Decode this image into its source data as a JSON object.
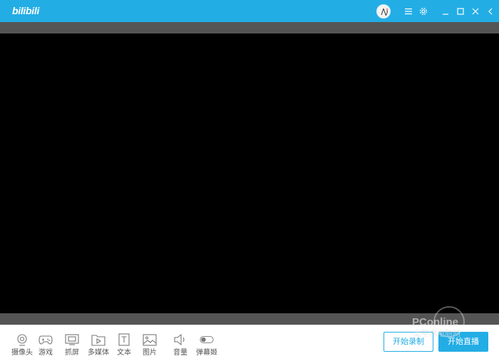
{
  "app": {
    "logo_text": "bilibili"
  },
  "titlebar": {
    "icons": [
      "avatar",
      "menu-icon",
      "settings-icon",
      "minimize-icon",
      "maximize-icon",
      "close-icon",
      "collapse-icon"
    ]
  },
  "toolbar": {
    "items": [
      {
        "label": "摄像头",
        "icon": "camera-icon"
      },
      {
        "label": "游戏",
        "icon": "gamepad-icon"
      },
      {
        "label": "抓屏",
        "icon": "screen-capture-icon"
      },
      {
        "label": "多媒体",
        "icon": "media-folder-icon"
      },
      {
        "label": "文本",
        "icon": "text-icon"
      },
      {
        "label": "图片",
        "icon": "image-icon"
      },
      {
        "label": "音量",
        "icon": "volume-icon"
      },
      {
        "label": "弹幕姬",
        "icon": "toggle-icon"
      }
    ],
    "record_label": "开始录制",
    "live_label": "开始直播"
  },
  "watermark": {
    "text": "PConline",
    "subtext": "太平洋电脑网"
  },
  "colors": {
    "accent": "#23ade5",
    "preview": "#000000",
    "bar": "#555555"
  }
}
